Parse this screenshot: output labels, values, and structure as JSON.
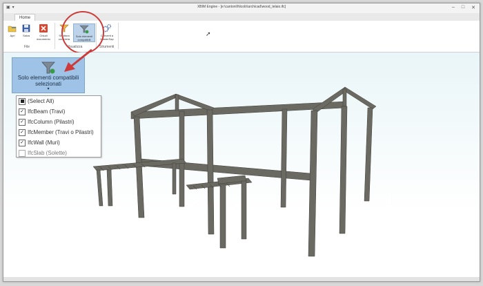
{
  "window": {
    "title": "XBIM Engine - [e:\\cantoni\\Nicolò\\archicad\\wood_telaio.ifc]"
  },
  "tabs": [
    {
      "label": "Home"
    }
  ],
  "ribbon": {
    "buttons": [
      {
        "label": "Apri",
        "icon": "folder-icon"
      },
      {
        "label": "Salva",
        "icon": "save-icon"
      },
      {
        "label": "Chiudi documento",
        "icon": "close-icon"
      },
      {
        "label": "Struttura completa",
        "icon": "funnel-icon"
      },
      {
        "label": "Solo elementi compatibili",
        "icon": "funnel-icon"
      },
      {
        "label": "Converti a MasterSap",
        "icon": "gears-icon"
      }
    ],
    "groups": [
      {
        "label": "File"
      },
      {
        "label": "Visualizza"
      },
      {
        "label": "Strumenti"
      }
    ]
  },
  "dropdown": {
    "label": "Solo elementi compatibili selezionati",
    "arrow": "▾",
    "items": [
      {
        "label": "(Select All)",
        "state": "indeterminate"
      },
      {
        "label": "IfcBeam (Travi)",
        "state": "checked"
      },
      {
        "label": "IfcColumn (Pilastri)",
        "state": "checked"
      },
      {
        "label": "IfcMember (Travi o Pilastri)",
        "state": "checked"
      },
      {
        "label": "IfcWall (Muri)",
        "state": "checked"
      },
      {
        "label": "IfcSlab (Solette)",
        "state": "unchecked"
      }
    ]
  },
  "colors": {
    "accent": "#9fc3e6",
    "highlight": "#cc3a3a",
    "structure": "#6b6a62"
  }
}
